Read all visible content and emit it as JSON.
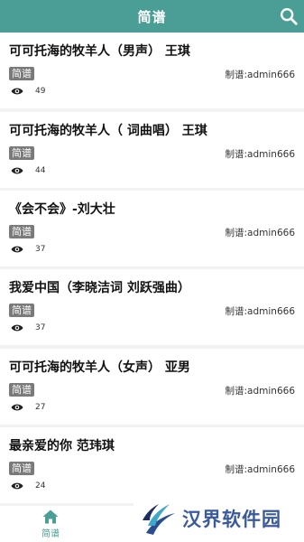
{
  "header": {
    "title": "简谱"
  },
  "items": [
    {
      "title": "可可托海的牧羊人（男声） 王琪",
      "tag": "简谱",
      "maker": "制谱:admin666",
      "views": "49"
    },
    {
      "title": "可可托海的牧羊人（ 词曲唱） 王琪",
      "tag": "简谱",
      "maker": "制谱:admin666",
      "views": "44"
    },
    {
      "title": "《会不会》-刘大壮",
      "tag": "简谱",
      "maker": "制谱:admin666",
      "views": "37"
    },
    {
      "title": "我爱中国（李晓洁词 刘跃强曲）",
      "tag": "简谱",
      "maker": "制谱:admin666",
      "views": "37"
    },
    {
      "title": "可可托海的牧羊人（女声） 亚男",
      "tag": "简谱",
      "maker": "制谱:admin666",
      "views": "27"
    },
    {
      "title": "最亲爱的你 范玮琪",
      "tag": "简谱",
      "maker": "制谱:admin666",
      "views": "24"
    }
  ],
  "bottom_nav": {
    "home_label": "简谱"
  },
  "watermark": {
    "text": "汉界软件园"
  },
  "colors": {
    "accent": "#4a9e96"
  },
  "icons": {
    "search": "search-icon",
    "views": "eye-icon",
    "home": "home-icon"
  }
}
